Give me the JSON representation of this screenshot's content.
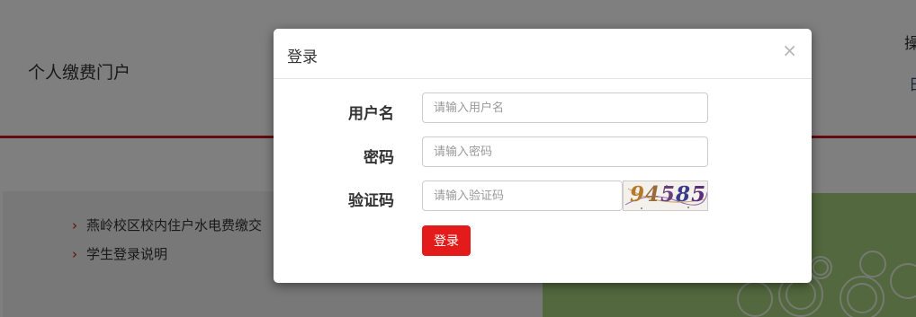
{
  "page": {
    "portal_title": "个人缴费门户",
    "header_right_1": "操",
    "header_right_2": "日",
    "notices": [
      {
        "label": "燕岭校区校内住户水电费缴交"
      },
      {
        "label": "学生登录说明"
      }
    ],
    "notice_chevron": "›",
    "accent_color": "#c6161e"
  },
  "modal": {
    "title": "登录",
    "close_label": "×",
    "username": {
      "label": "用户名",
      "placeholder": "请输入用户名",
      "value": ""
    },
    "password": {
      "label": "密码",
      "placeholder": "请输入密码",
      "value": ""
    },
    "captcha": {
      "label": "验证码",
      "placeholder": "请输入验证码",
      "value": "",
      "image_text": "94585"
    },
    "submit_label": "登录",
    "submit_color": "#e31b1b"
  }
}
